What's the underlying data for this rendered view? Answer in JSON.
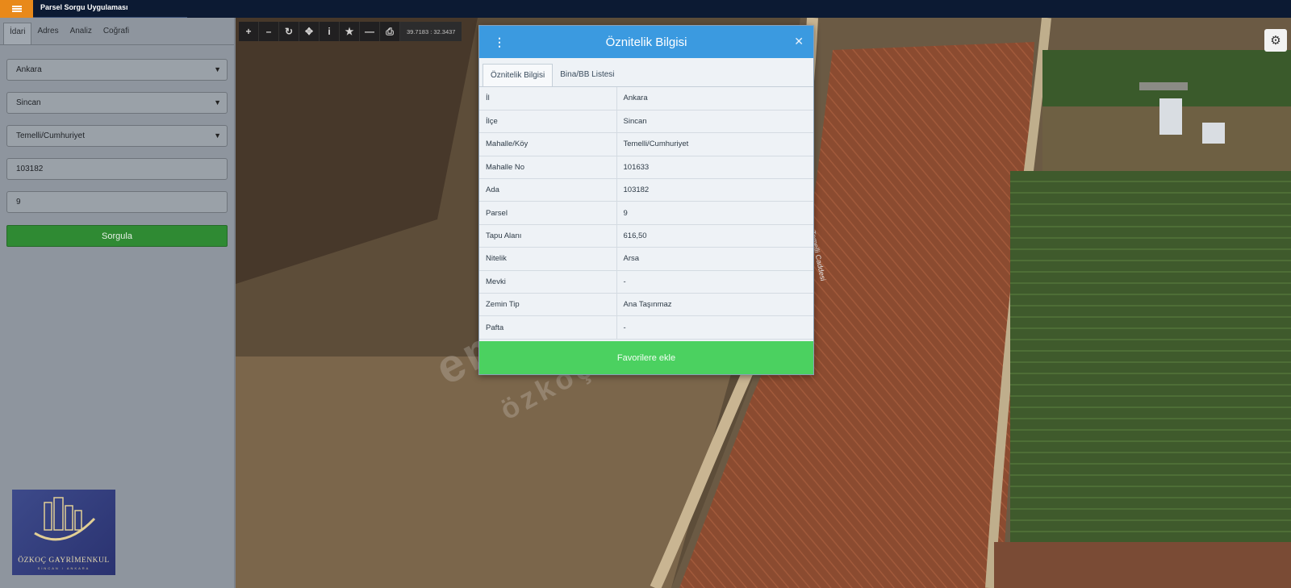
{
  "app": {
    "title": "Parsel Sorgu Uygulaması"
  },
  "sidebar": {
    "tabs": [
      {
        "label": "İdari"
      },
      {
        "label": "Adres"
      },
      {
        "label": "Analiz"
      },
      {
        "label": "Coğrafi"
      }
    ],
    "il": "Ankara",
    "ilce": "Sincan",
    "mahalle": "Temelli/Cumhuriyet",
    "ada": "103182",
    "parsel": "9",
    "submit_label": "Sorgula"
  },
  "toolbar": {
    "coords": "39.7183 : 32.3437",
    "icons": [
      "zoom-in-icon",
      "zoom-out-icon",
      "refresh-icon",
      "locate-icon",
      "info-icon",
      "star-icon",
      "minus-icon",
      "print-icon"
    ]
  },
  "popup": {
    "title": "Öznitelik Bilgisi",
    "tabs": [
      {
        "label": "Öznitelik Bilgisi"
      },
      {
        "label": "Bina/BB Listesi"
      }
    ],
    "rows": [
      {
        "key": "İl",
        "value": "Ankara"
      },
      {
        "key": "İlçe",
        "value": "Sincan"
      },
      {
        "key": "Mahalle/Köy",
        "value": "Temelli/Cumhuriyet"
      },
      {
        "key": "Mahalle No",
        "value": "101633"
      },
      {
        "key": "Ada",
        "value": "103182"
      },
      {
        "key": "Parsel",
        "value": "9"
      },
      {
        "key": "Tapu Alanı",
        "value": "616,50"
      },
      {
        "key": "Nitelik",
        "value": "Arsa"
      },
      {
        "key": "Mevki",
        "value": "-"
      },
      {
        "key": "Zemin Tip",
        "value": "Ana Taşınmaz"
      },
      {
        "key": "Pafta",
        "value": "-"
      }
    ],
    "fav_label": "Favorilere ekle"
  },
  "watermark": {
    "line1": "emlakjet.com",
    "line2": "özkoç"
  },
  "logo": {
    "name": "ÖZKOÇ GAYRİMENKUL",
    "sub": "SİNCAN / ANKARA"
  },
  "map": {
    "road_label": "Temelli Caddesi"
  },
  "colors": {
    "header": "#3b9ae0",
    "fav": "#4bd160",
    "sorgula": "#2f8a33",
    "menu": "#e8891a"
  }
}
